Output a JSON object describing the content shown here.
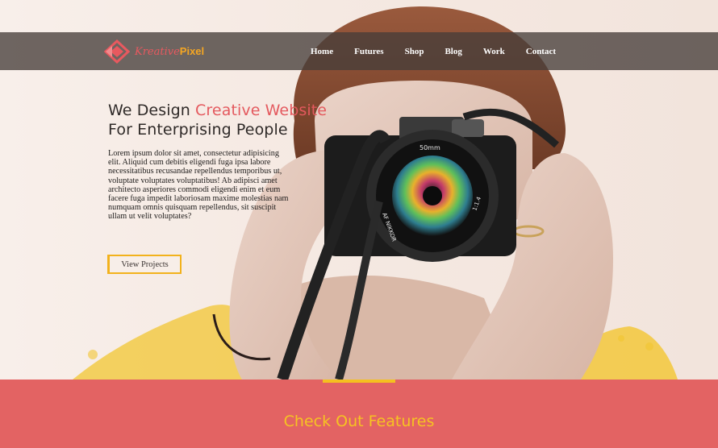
{
  "brand": {
    "name_part1": "Kreative",
    "name_part2": "Pixel",
    "accent_color": "#e36363",
    "highlight_color": "#f5c01f"
  },
  "nav": {
    "items": [
      {
        "label": "Home"
      },
      {
        "label": "Futures"
      },
      {
        "label": "Shop"
      },
      {
        "label": "Blog"
      },
      {
        "label": "Work"
      },
      {
        "label": "Contact"
      }
    ]
  },
  "hero": {
    "headline_part1": "We Design ",
    "headline_accent": "Creative Website",
    "headline_line2": "For Enterprising People",
    "body": "Lorem ipsum dolor sit amet, consectetur adipisicing elit. Aliquid cum debitis eligendi fuga ipsa labore necessitatibus recusandae repellendus temporibus ut, voluptate voluptates voluptatibus! Ab adipisci amet architecto asperiores commodi eligendi enim et eum facere fuga impedit laboriosam maxime molestias nam numquam omnis quisquam repellendus, sit suscipit ullam ut velit voluptates?",
    "cta_label": "View Projects",
    "lens_label_top": "50mm",
    "lens_label_left": "AF NIKKOR",
    "lens_label_right": "1:1.4"
  },
  "features": {
    "title_part1": "Check Out ",
    "title_part2": "Features"
  }
}
